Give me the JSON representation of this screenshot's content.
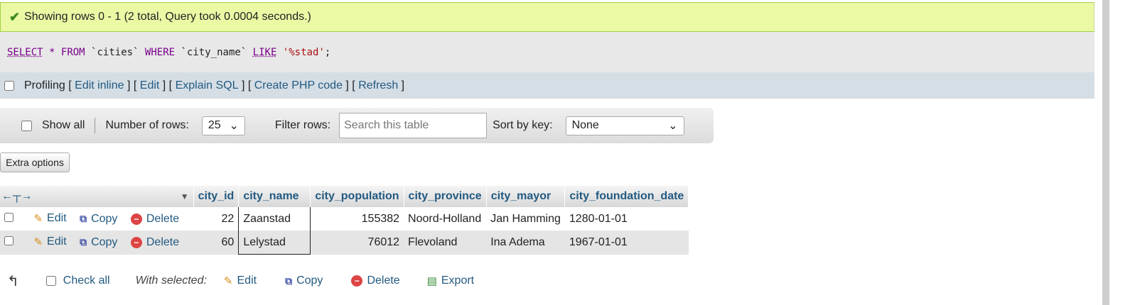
{
  "message": {
    "text": "Showing rows 0 - 1 (2 total, Query took 0.0004 seconds.)"
  },
  "sql": {
    "select": "SELECT",
    "star": "*",
    "from": "FROM",
    "table": "`cities`",
    "where": "WHERE",
    "column": "`city_name`",
    "like": "LIKE",
    "value": "'%stad'",
    "end": ";"
  },
  "tools": {
    "profiling": "Profiling",
    "links": [
      "Edit inline",
      "Edit",
      "Explain SQL",
      "Create PHP code",
      "Refresh"
    ]
  },
  "nav": {
    "show_all": "Show all",
    "rows_label": "Number of rows:",
    "rows_value": "25",
    "filter_label": "Filter rows:",
    "filter_placeholder": "Search this table",
    "sort_label": "Sort by key:",
    "sort_value": "None"
  },
  "extra_options": "Extra options",
  "table": {
    "columns": [
      "city_id",
      "city_name",
      "city_population",
      "city_province",
      "city_mayor",
      "city_foundation_date"
    ],
    "actions": {
      "edit": "Edit",
      "copy": "Copy",
      "delete": "Delete"
    },
    "rows": [
      {
        "city_id": "22",
        "city_name": "Zaanstad",
        "city_population": "155382",
        "city_province": "Noord-Holland",
        "city_mayor": "Jan Hamming",
        "city_foundation_date": "1280-01-01"
      },
      {
        "city_id": "60",
        "city_name": "Lelystad",
        "city_population": "76012",
        "city_province": "Flevoland",
        "city_mayor": "Ina Adema",
        "city_foundation_date": "1967-01-01"
      }
    ]
  },
  "footer": {
    "check_all": "Check all",
    "with_selected": "With selected:",
    "edit": "Edit",
    "copy": "Copy",
    "delete": "Delete",
    "export": "Export"
  }
}
